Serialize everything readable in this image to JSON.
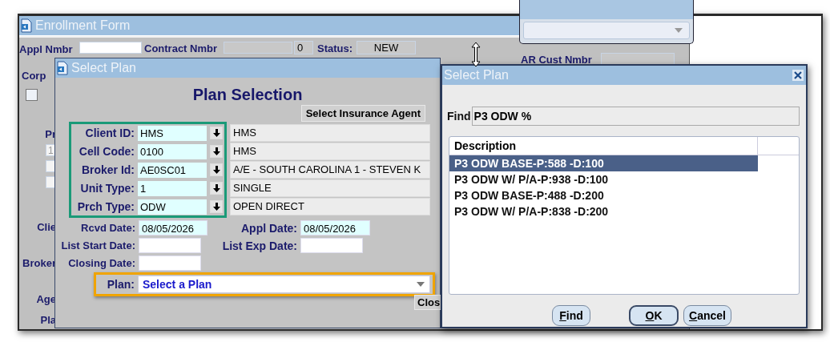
{
  "enrollment_form": {
    "title": "Enrollment Form",
    "appl_nmbr_label": "Appl Nmbr",
    "contract_nmbr_label": "Contract Nmbr",
    "contract_count": "0",
    "status_label": "Status:",
    "status_value": "NEW",
    "ar_cust_nmbr_label": "AR Cust Nmbr",
    "corp_label": "Corp",
    "corp_checked": false,
    "side_labels": [
      "Pr",
      "Clie",
      "Broker",
      "Age",
      "Pla"
    ],
    "prod_field": "1"
  },
  "plan_selection_window": {
    "title": "Select Plan",
    "heading": "Plan Selection",
    "agent_button": "Select Insurance Agent",
    "lookups": [
      {
        "label": "Client ID:",
        "code": "HMS",
        "description": "HMS"
      },
      {
        "label": "Cell Code:",
        "code": "0100",
        "description": "HMS"
      },
      {
        "label": "Broker Id:",
        "code": "AE0SC01",
        "description": "A/E - SOUTH CAROLINA 1 - STEVEN K"
      },
      {
        "label": "Unit Type:",
        "code": "1",
        "description": "SINGLE"
      },
      {
        "label": "Prch Type:",
        "code": "ODW",
        "description": "OPEN DIRECT"
      }
    ],
    "dates": [
      {
        "label": "Rcvd Date:",
        "value": "08/05/2026"
      },
      {
        "label": "Appl Date:",
        "value": "08/05/2026"
      },
      {
        "label": "List Start Date:"
      },
      {
        "label": "List Exp Date:"
      },
      {
        "label": "Closing Date:"
      }
    ],
    "plan": {
      "label": "Plan:",
      "value": "Select a Plan"
    },
    "close_button": "Clos"
  },
  "select_plan_dialog": {
    "title": "Select Plan",
    "find_label": "Find",
    "find_value": "P3 ODW %",
    "list": {
      "columns": [
        "Description"
      ],
      "rows": [
        {
          "description": "P3 ODW BASE-P:588 -D:100",
          "selected": true
        },
        {
          "description": "P3 ODW W/ P/A-P:938 -D:100",
          "selected": false
        },
        {
          "description": "P3 ODW BASE-P:488 -D:200",
          "selected": false
        },
        {
          "description": "P3 ODW W/ P/A-P:838 -D:200",
          "selected": false
        }
      ]
    },
    "buttons": [
      {
        "label": "Find",
        "default": false
      },
      {
        "label": "OK",
        "default": true
      },
      {
        "label": "Cancel",
        "default": false
      }
    ]
  }
}
